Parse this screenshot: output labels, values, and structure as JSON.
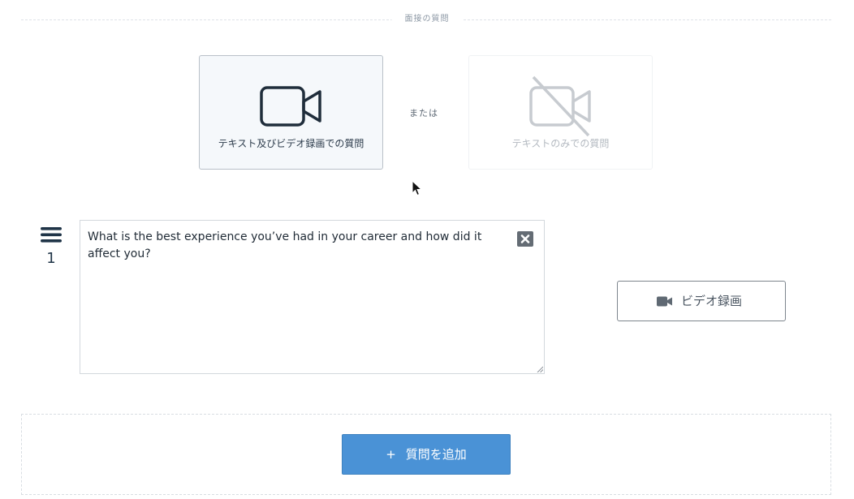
{
  "section": {
    "title": "面接の質問"
  },
  "modes": {
    "video_label": "テキスト及びビデオ録画での質問",
    "or_label": "または",
    "text_label": "テキストのみでの質問",
    "video_icon": "video-camera-icon",
    "text_icon": "video-camera-off-icon"
  },
  "question": {
    "number": "1",
    "text": "What is the best experience you’ve had in your career and how did it affect you?",
    "drag_icon": "hamburger-menu-icon",
    "delete_icon": "close-icon"
  },
  "record": {
    "label": "ビデオ録画",
    "icon": "video-camera-icon"
  },
  "add": {
    "plus": "+",
    "label": "質問を追加"
  },
  "colors": {
    "accent": "#4a92d6",
    "dark": "#1f3447",
    "muted": "#b3b9c0"
  }
}
